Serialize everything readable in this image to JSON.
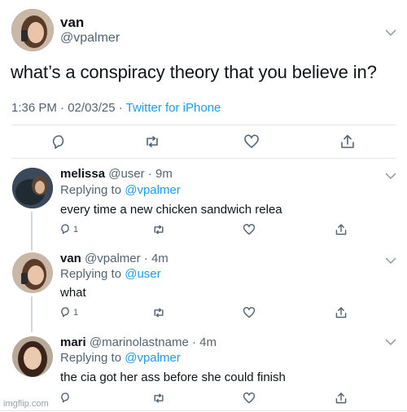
{
  "main_tweet": {
    "name": "van",
    "handle": "@vpalmer",
    "text": "what’s a conspiracy theory that you believe in?",
    "time": "1:36 PM",
    "date": "02/03/25",
    "client": "Twitter for iPhone"
  },
  "replies": [
    {
      "name": "melissa",
      "handle": "@user",
      "ago": "9m",
      "replying_label": "Replying to",
      "replying_to": "@vpalmer",
      "text": "every time a new chicken sandwich relea",
      "reply_count": "1"
    },
    {
      "name": "van",
      "handle": "@vpalmer",
      "ago": "4m",
      "replying_label": "Replying to",
      "replying_to": "@user",
      "text": "what",
      "reply_count": "1"
    },
    {
      "name": "mari",
      "handle": "@marinolastname",
      "ago": "4m",
      "replying_label": "Replying to",
      "replying_to": "@vpalmer",
      "text": "the cia got her ass before she could finish",
      "reply_count": ""
    }
  ],
  "separator": " · ",
  "watermark": "imgflip.com",
  "colors": {
    "link": "#1d9bf0",
    "muted": "#536471",
    "text": "#0f1419",
    "line": "#cfd9de"
  }
}
